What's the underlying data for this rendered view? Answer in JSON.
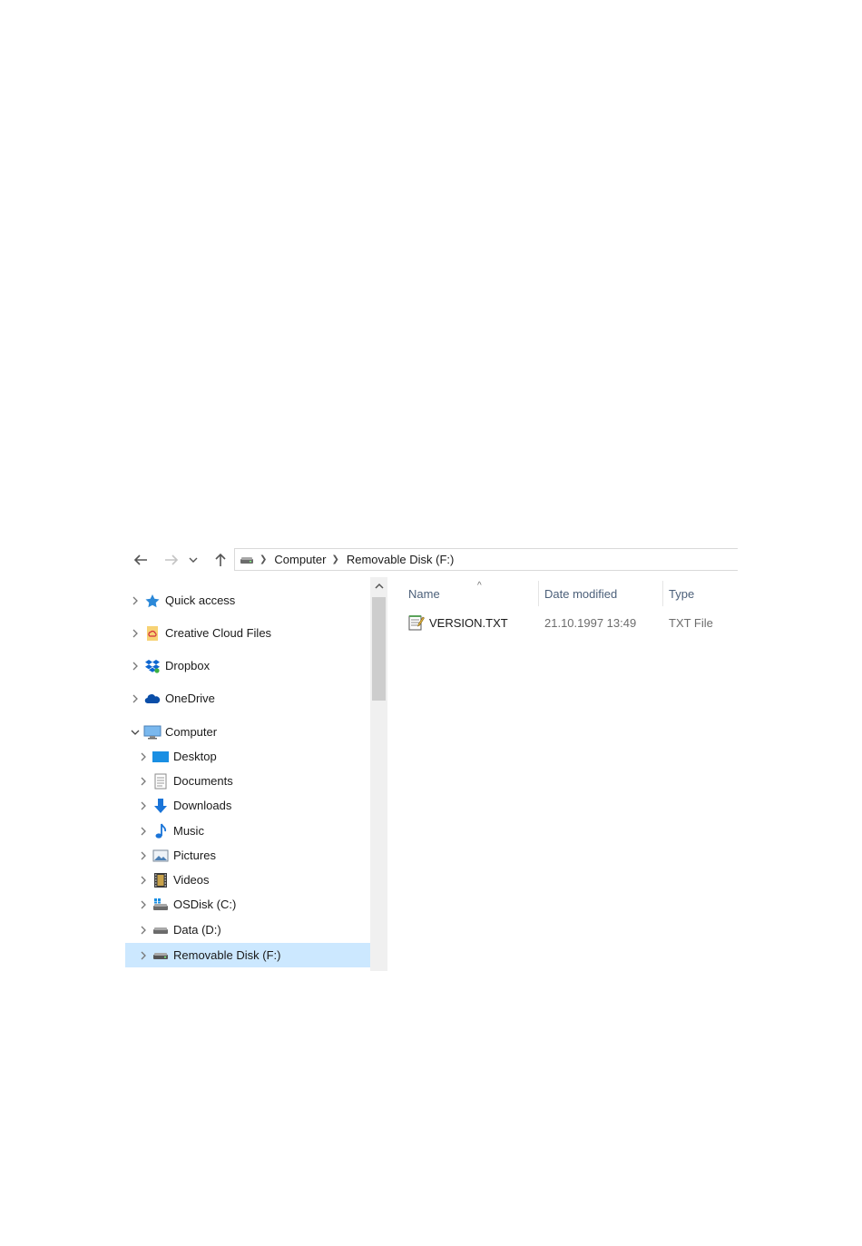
{
  "breadcrumb": [
    "Computer",
    "Removable Disk (F:)"
  ],
  "nav_tree": [
    {
      "label": "Quick access",
      "icon": "quick-access-star-icon",
      "expanded": false
    },
    {
      "label": "Creative Cloud Files",
      "icon": "creative-cloud-folder-icon",
      "expanded": false
    },
    {
      "label": "Dropbox",
      "icon": "dropbox-icon",
      "expanded": false
    },
    {
      "label": "OneDrive",
      "icon": "onedrive-cloud-icon",
      "expanded": false
    },
    {
      "label": "Computer",
      "icon": "computer-monitor-icon",
      "expanded": true
    },
    {
      "label": "Desktop",
      "icon": "desktop-icon",
      "expanded": false
    },
    {
      "label": "Documents",
      "icon": "documents-icon",
      "expanded": false
    },
    {
      "label": "Downloads",
      "icon": "downloads-arrow-icon",
      "expanded": false
    },
    {
      "label": "Music",
      "icon": "music-note-icon",
      "expanded": false
    },
    {
      "label": "Pictures",
      "icon": "pictures-icon",
      "expanded": false
    },
    {
      "label": "Videos",
      "icon": "videos-filmstrip-icon",
      "expanded": false
    },
    {
      "label": "OSDisk (C:)",
      "icon": "os-drive-icon",
      "expanded": false
    },
    {
      "label": "Data (D:)",
      "icon": "drive-icon",
      "expanded": false
    },
    {
      "label": "Removable Disk (F:)",
      "icon": "removable-drive-icon",
      "expanded": false,
      "selected": true
    }
  ],
  "columns": {
    "name": "Name",
    "date_modified": "Date modified",
    "type": "Type"
  },
  "files": [
    {
      "name": "VERSION.TXT",
      "date_modified": "21.10.1997 13:49",
      "type": "TXT File",
      "icon": "text-file-icon"
    }
  ],
  "colors": {
    "selection": "#cce8ff",
    "header_text": "#4c607a",
    "accent_blue": "#1e90ff"
  }
}
